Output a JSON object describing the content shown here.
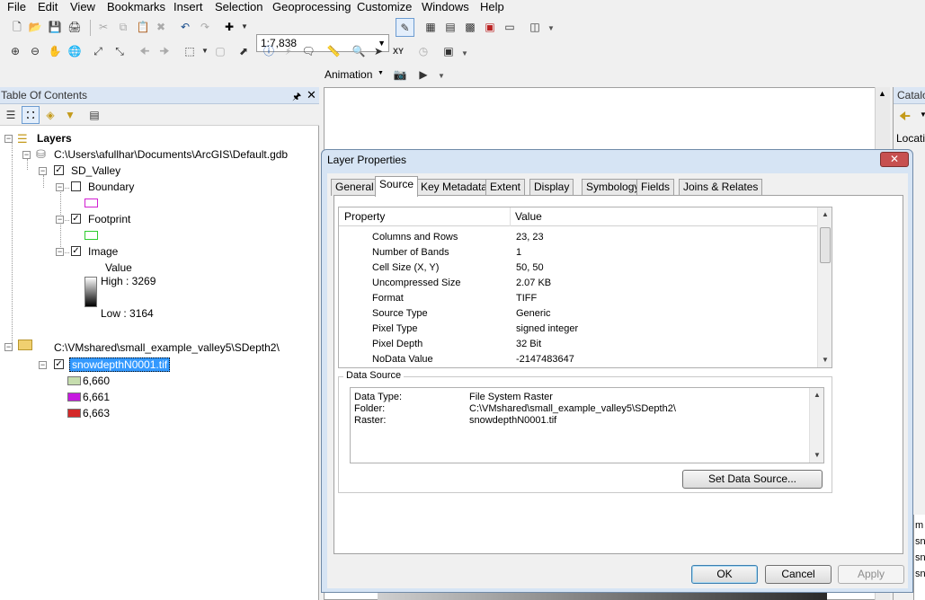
{
  "menubar": {
    "items": [
      "File",
      "Edit",
      "View",
      "Bookmarks",
      "Insert",
      "Selection",
      "Geoprocessing",
      "Customize",
      "Windows",
      "Help"
    ]
  },
  "toolbar": {
    "scale_value": "1:7,838",
    "animation_label": "Animation"
  },
  "toc": {
    "title": "Table Of Contents",
    "root_label": "Layers",
    "gdb_path": "C:\\Users\\afullhar\\Documents\\ArcGIS\\Default.gdb",
    "dataset_label": "SD_Valley",
    "layers": [
      {
        "label": "Boundary",
        "checked": false,
        "swatch_color": "#d21fd2"
      },
      {
        "label": "Footprint",
        "checked": true,
        "swatch_color": "#2ecc2e"
      },
      {
        "label": "Image",
        "checked": true
      }
    ],
    "legend": {
      "title": "Value",
      "high": "High : 3269",
      "low": "Low : 3164"
    },
    "folder_path": "C:\\VMshared\\small_example_valley5\\SDepth2\\",
    "raster_label": "snowdepthN0001.tif",
    "classes": [
      {
        "label": "6,660",
        "color": "#c6ddae"
      },
      {
        "label": "6,661",
        "color": "#c61ae0"
      },
      {
        "label": "6,663",
        "color": "#d42828"
      }
    ]
  },
  "catalog": {
    "title": "Catalo",
    "location_label": "Locatio"
  },
  "dialog": {
    "title": "Layer Properties",
    "tabs": [
      "General",
      "Source",
      "Key Metadata",
      "Extent",
      "Display",
      "Symbology",
      "Fields",
      "Joins & Relates"
    ],
    "active_tab": "Source",
    "prop_headers": {
      "property": "Property",
      "value": "Value"
    },
    "properties": [
      {
        "k": "Columns and Rows",
        "v": "23, 23"
      },
      {
        "k": "Number of Bands",
        "v": "1"
      },
      {
        "k": "Cell Size (X, Y)",
        "v": "50, 50"
      },
      {
        "k": "Uncompressed Size",
        "v": "2.07 KB"
      },
      {
        "k": "Format",
        "v": "TIFF"
      },
      {
        "k": "Source Type",
        "v": "Generic"
      },
      {
        "k": "Pixel Type",
        "v": "signed integer"
      },
      {
        "k": "Pixel Depth",
        "v": "32 Bit"
      },
      {
        "k": "NoData Value",
        "v": "-2147483647"
      }
    ],
    "data_source_label": "Data Source",
    "data_source": [
      {
        "k": "Data Type:",
        "v": "File System Raster"
      },
      {
        "k": "Folder:",
        "v": "C:\\VMshared\\small_example_valley5\\SDepth2\\"
      },
      {
        "k": "Raster:",
        "v": "snowdepthN0001.tif"
      }
    ],
    "set_source_label": "Set Data Source...",
    "ok_label": "OK",
    "cancel_label": "Cancel",
    "apply_label": "Apply"
  }
}
